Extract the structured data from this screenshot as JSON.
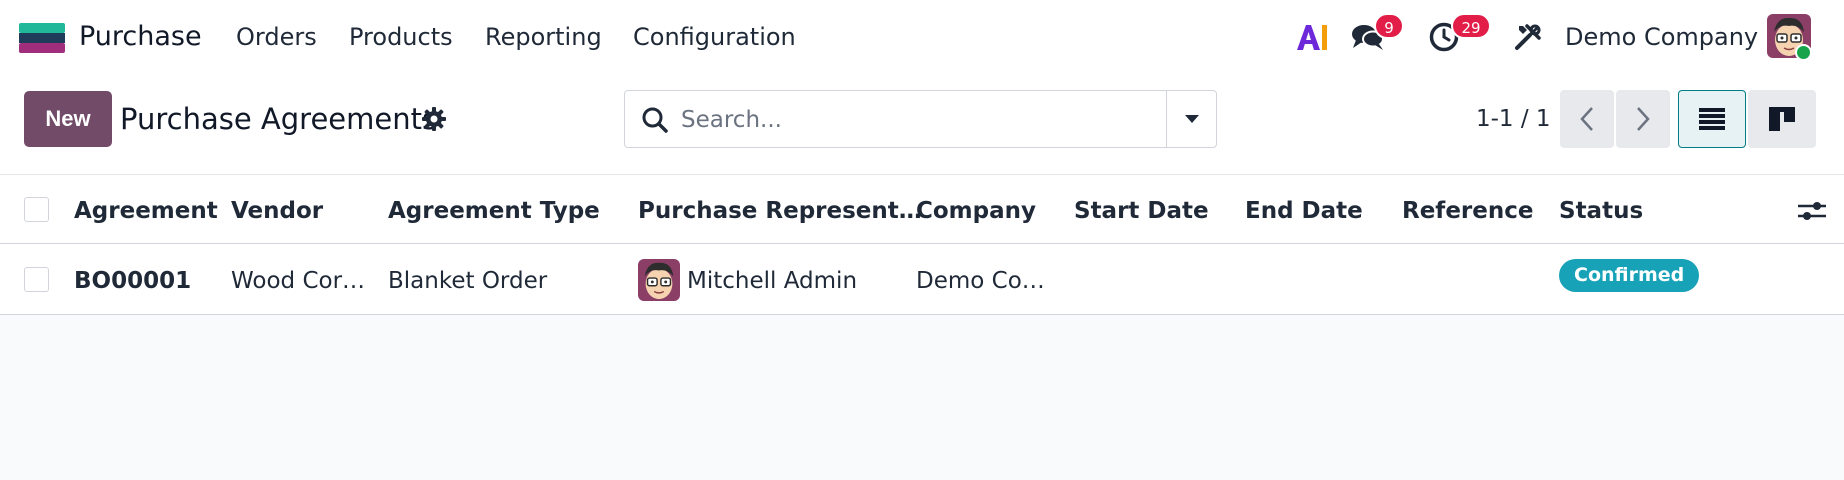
{
  "navbar": {
    "app_name": "Purchase",
    "menu": [
      "Orders",
      "Products",
      "Reporting",
      "Configuration"
    ],
    "messages_count": "9",
    "activities_count": "29",
    "company": "Demo Company"
  },
  "control_panel": {
    "new_label": "New",
    "title": "Purchase Agreements",
    "search_placeholder": "Search...",
    "pager": "1-1 / 1"
  },
  "table": {
    "columns": [
      "Agreement",
      "Vendor",
      "Agreement Type",
      "Purchase Represent…",
      "Company",
      "Start Date",
      "End Date",
      "Reference",
      "Status"
    ],
    "rows": [
      {
        "agreement": "BO00001",
        "vendor": "Wood Cor…",
        "agreement_type": "Blanket Order",
        "representative": "Mitchell Admin",
        "company": "Demo Co…",
        "start_date": "",
        "end_date": "",
        "reference": "",
        "status": "Confirmed"
      }
    ]
  },
  "colors": {
    "brand": "#714b67",
    "accent": "#017e84",
    "badge": "#e11d48",
    "status_confirmed": "#17a2b8"
  },
  "icons": [
    "app-logo-icon",
    "ai-icon",
    "chat-icon",
    "clock-icon",
    "tools-icon",
    "gear-icon",
    "search-icon",
    "caret-down-icon",
    "chevron-left-icon",
    "chevron-right-icon",
    "list-view-icon",
    "kanban-view-icon",
    "column-settings-icon"
  ]
}
